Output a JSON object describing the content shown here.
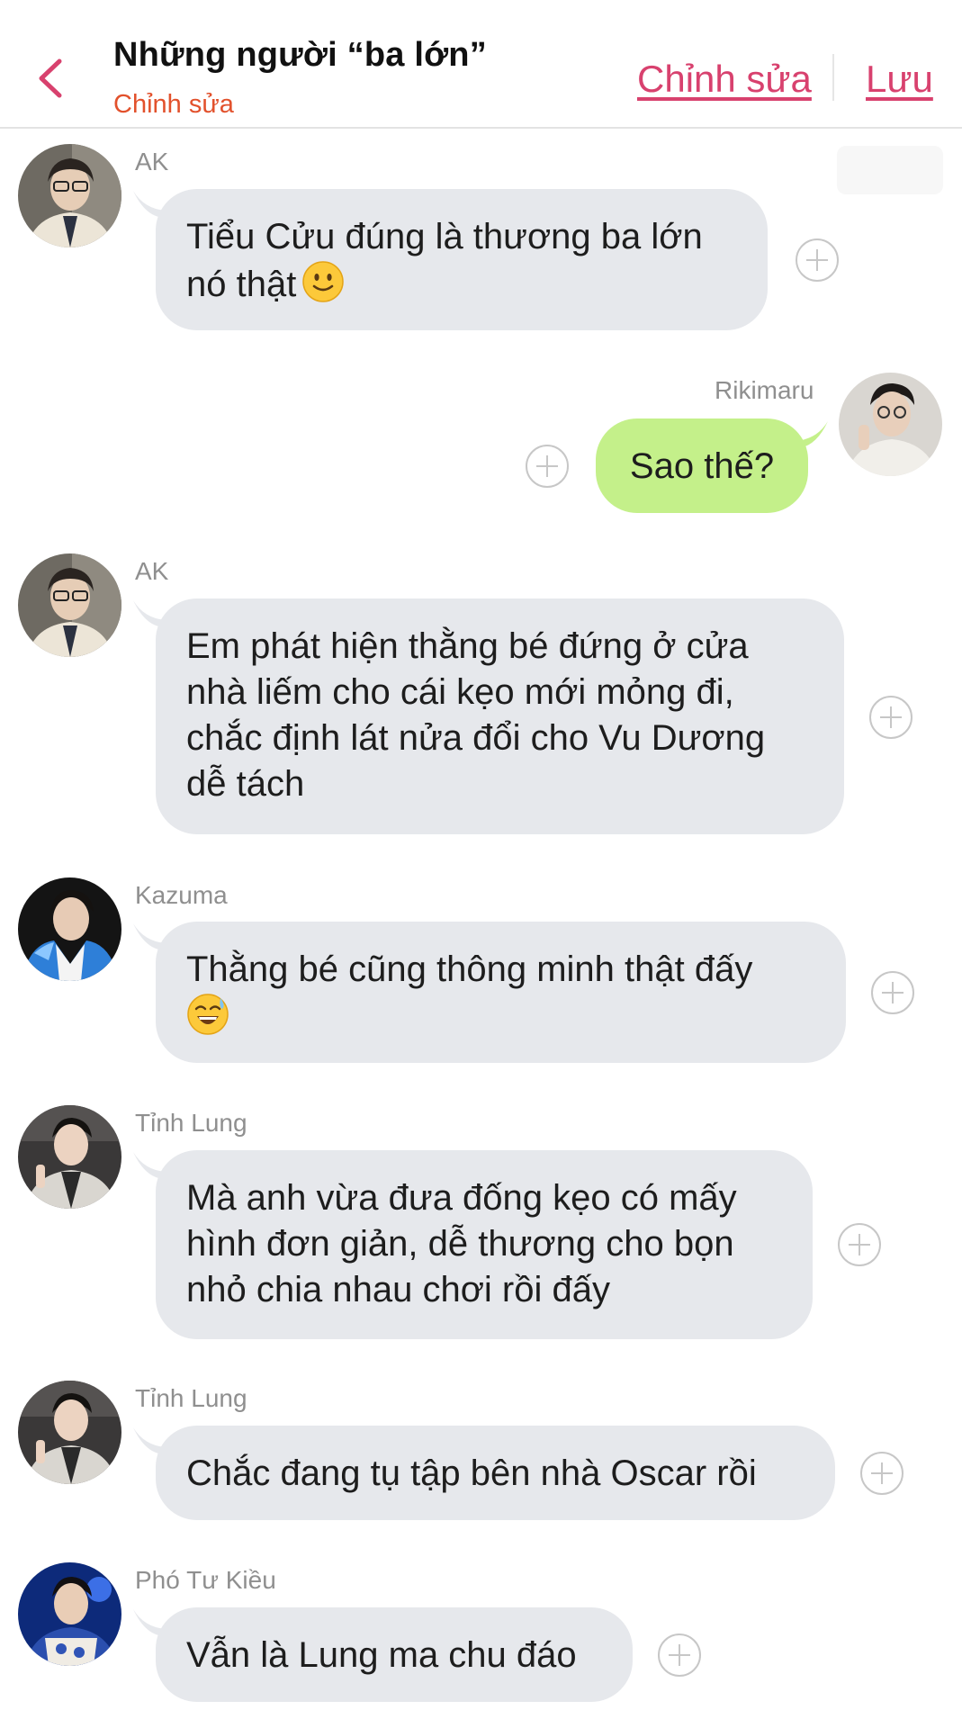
{
  "header": {
    "title": "Những người “ba lớn”",
    "subtitle": "Chỉnh sửa",
    "edit_label": "Chỉnh sửa",
    "save_label": "Lưu",
    "accent_color": "#d8416e",
    "subtitle_color": "#e2512c"
  },
  "messages": [
    {
      "sender": "AK",
      "side": "left",
      "text_lines": [
        "Tiểu Cửu đúng là thương ba lớn",
        "nó thật"
      ],
      "emoji": "slight-smile-emoji"
    },
    {
      "sender": "Rikimaru",
      "side": "right",
      "text_lines": [
        "Sao thế?"
      ],
      "bubble_color": "#c4f08a"
    },
    {
      "sender": "AK",
      "side": "left",
      "text_lines": [
        "Em phát hiện thằng bé đứng ở cửa",
        "nhà liếm cho cái kẹo mới mỏng đi,",
        "chắc định lát nửa đổi cho Vu Dương",
        "dễ tách"
      ]
    },
    {
      "sender": "Kazuma",
      "side": "left",
      "text_lines": [
        "Thằng bé cũng thông minh thật đấy",
        ""
      ],
      "emoji": "sweat-smile-emoji"
    },
    {
      "sender": "Tỉnh Lung",
      "side": "left",
      "text_lines": [
        "Mà anh vừa đưa đống kẹo có mấy",
        "hình đơn giản, dễ thương cho bọn",
        "nhỏ chia nhau chơi rồi đấy"
      ]
    },
    {
      "sender": "Tỉnh Lung",
      "side": "left",
      "text_lines": [
        "Chắc đang tụ tập bên nhà Oscar rồi"
      ]
    },
    {
      "sender": "Phó Tư Kiều",
      "side": "left",
      "text_lines": [
        "Vẫn là Lung ma chu đáo"
      ]
    }
  ]
}
